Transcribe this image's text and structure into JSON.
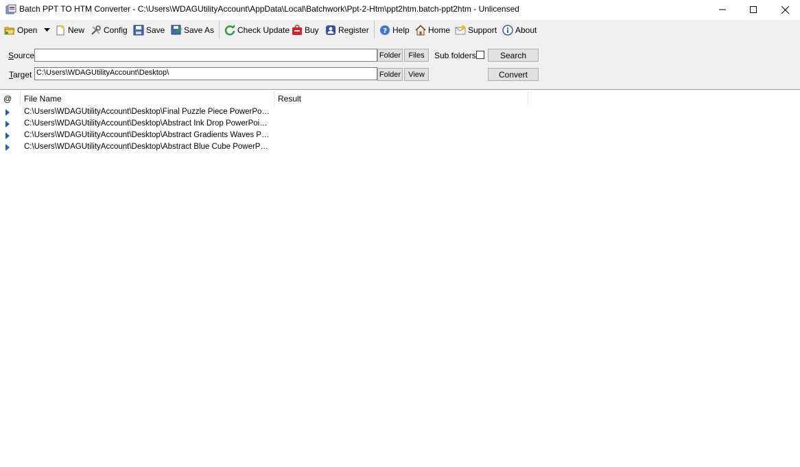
{
  "window": {
    "title": "Batch PPT TO HTM Converter - C:\\Users\\WDAGUtilityAccount\\AppData\\Local\\Batchwork\\Ppt-2-Htm\\ppt2htm.batch-ppt2htm - Unlicensed"
  },
  "toolbar": {
    "open": "Open",
    "new": "New",
    "config": "Config",
    "save": "Save",
    "save_as": "Save As",
    "check_update": "Check Update",
    "buy": "Buy",
    "register": "Register",
    "help": "Help",
    "home": "Home",
    "support": "Support",
    "about": "About"
  },
  "form": {
    "source_label_ul": "S",
    "source_label_rest": "ource",
    "source_value": "",
    "target_label_ul": "T",
    "target_label_rest": "arget",
    "target_value": "C:\\Users\\WDAGUtilityAccount\\Desktop\\",
    "folder": "Folder",
    "files": "Files",
    "view": "View",
    "sub_folders": "Sub folders",
    "sub_folders_checked": false,
    "search": "Search",
    "convert": "Convert"
  },
  "list": {
    "columns": [
      "@",
      "File Name",
      "Result"
    ],
    "rows": [
      {
        "file": "C:\\Users\\WDAGUtilityAccount\\Desktop\\Final Puzzle Piece PowerPoint Template.pptx",
        "result": ""
      },
      {
        "file": "C:\\Users\\WDAGUtilityAccount\\Desktop\\Abstract Ink Drop PowerPoint Template.pptx",
        "result": ""
      },
      {
        "file": "C:\\Users\\WDAGUtilityAccount\\Desktop\\Abstract Gradients Waves PowerPoint Template.pptx",
        "result": ""
      },
      {
        "file": "C:\\Users\\WDAGUtilityAccount\\Desktop\\Abstract Blue Cube PowerPoint Template.pptx",
        "result": ""
      }
    ]
  },
  "colors": {
    "toolbar_bg": "#f0f0f0",
    "row_arrow": "#1e5fb4"
  }
}
